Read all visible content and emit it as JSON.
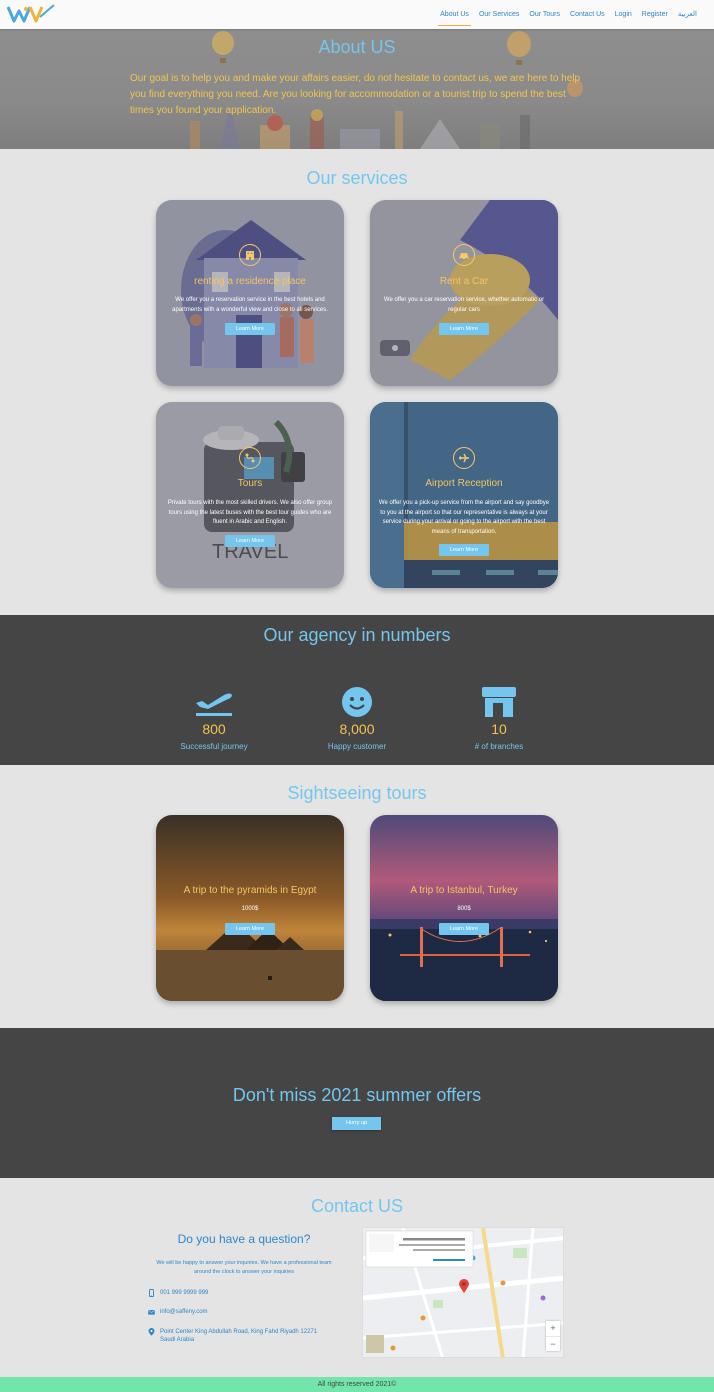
{
  "nav": {
    "links": [
      "About Us",
      "Our Services",
      "Our Tours",
      "Contact Us",
      "Login",
      "Register",
      "العربية"
    ]
  },
  "hero": {
    "title": "About US",
    "text": "Our goal is to help you and make your affairs easier, do not hesitate to contact us, we are here to help you find everything you need. Are you looking for accommodation or a tourist trip to spend the best times you found your application."
  },
  "services": {
    "title": "Our services",
    "items": [
      {
        "title": "renting a residence place",
        "desc": "We offer you a reservation service in the best hotels and apartments with a wonderful view and close to all services.",
        "button": "Learn More",
        "icon": "building-icon"
      },
      {
        "title": "Rent a Car",
        "desc": "We offer you a car reservation service, whether automatic or regular cars",
        "button": "Learn More",
        "icon": "car-icon"
      },
      {
        "title": "Tours",
        "desc": "Private tours with the most skilled drivers. We also offer group tours using the latest buses with the best tour guides who are fluent in Arabic and English.",
        "button": "Learn More",
        "icon": "route-icon"
      },
      {
        "title": "Airport Reception",
        "desc": "We offer you a pick-up service from the airport and say goodbye to you at the airport so that our representative is always at your service during your arrival or going to the airport with the best means of transportation.",
        "button": "Learn More",
        "icon": "plane-icon"
      }
    ]
  },
  "numbers": {
    "title": "Our agency in numbers",
    "items": [
      {
        "value": "800",
        "label": "Successful journey",
        "icon": "plane-departure-icon"
      },
      {
        "value": "8,000",
        "label": "Happy customer",
        "icon": "smile-icon"
      },
      {
        "value": "10",
        "label": "# of branches",
        "icon": "store-icon"
      }
    ]
  },
  "tours": {
    "title": "Sightseeing tours",
    "items": [
      {
        "title": "A trip to the pyramids in Egypt",
        "price": "1000$",
        "button": "Learn More"
      },
      {
        "title": "A trip to Istanbul, Turkey",
        "price": "800$",
        "button": "Learn More"
      }
    ]
  },
  "offer": {
    "title": "Don't miss 2021 summer offers",
    "button": "Hurry up"
  },
  "contact": {
    "title": "Contact US",
    "question": "Do you have a question?",
    "text": "We will be happy to answer your inquiries. We have a professional team around the clock to answer your inquiries",
    "phone": "001 999 9999 999",
    "email": "info@saffeny.com",
    "address": "Point Center King Abdullah Road, King Fahd Riyadh 12271 Saudi Arabia",
    "map_zoom_in": "+",
    "map_zoom_out": "−"
  },
  "footer": {
    "text": "All rights reserved 2021©"
  },
  "colors": {
    "accent_blue": "#74c6ee",
    "accent_gold": "#f3c44f",
    "dark": "#454545",
    "footer": "#72e5ad"
  }
}
